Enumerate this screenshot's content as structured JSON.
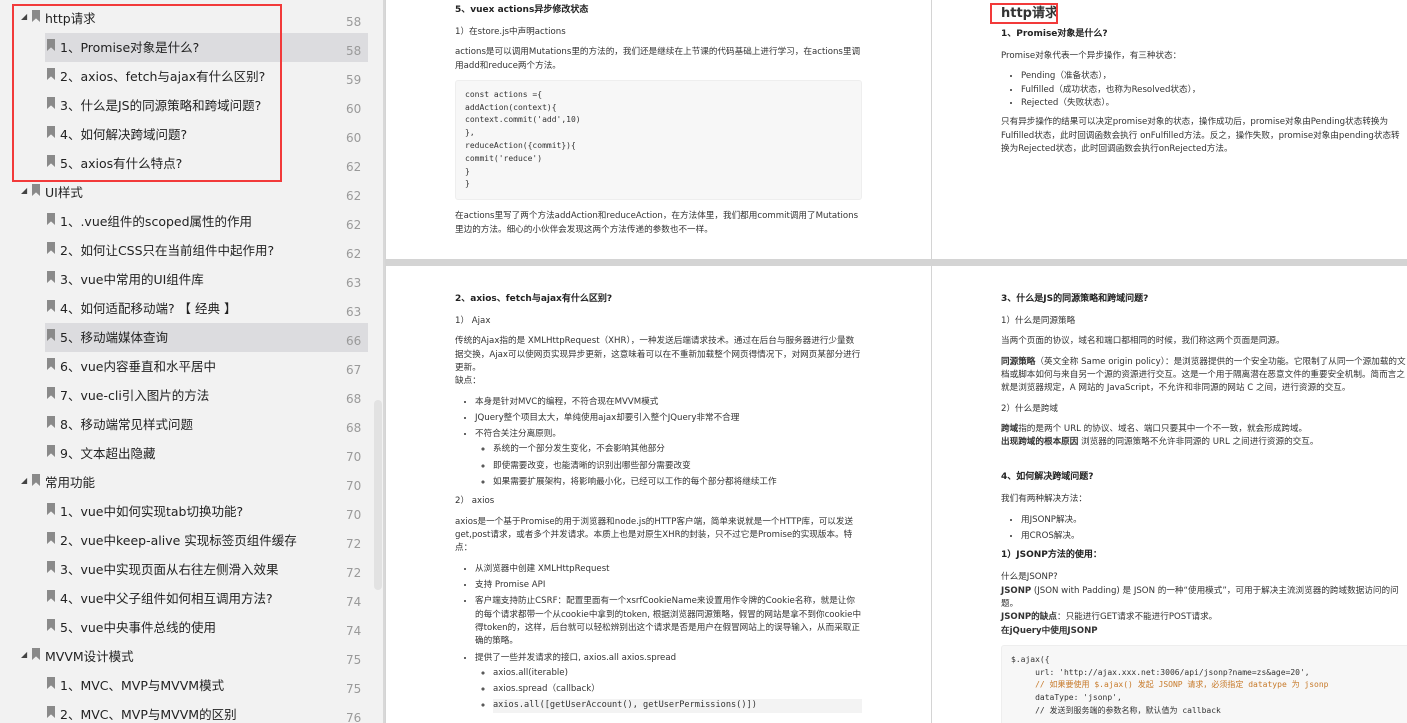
{
  "sidebar": {
    "items": [
      {
        "level": 0,
        "label": "http请求",
        "page": "58"
      },
      {
        "level": 1,
        "label": "1、Promise对象是什么?",
        "page": "58",
        "selected": true
      },
      {
        "level": 1,
        "label": "2、axios、fetch与ajax有什么区别?",
        "page": "59"
      },
      {
        "level": 1,
        "label": "3、什么是JS的同源策略和跨域问题?",
        "page": "60"
      },
      {
        "level": 1,
        "label": "4、如何解决跨域问题?",
        "page": "60"
      },
      {
        "level": 1,
        "label": "5、axios有什么特点?",
        "page": "62"
      },
      {
        "level": 0,
        "label": "UI样式",
        "page": "62"
      },
      {
        "level": 1,
        "label": "1、.vue组件的scoped属性的作用",
        "page": "62"
      },
      {
        "level": 1,
        "label": "2、如何让CSS只在当前组件中起作用?",
        "page": "62"
      },
      {
        "level": 1,
        "label": "3、vue中常用的UI组件库",
        "page": "63"
      },
      {
        "level": 1,
        "label": "4、如何适配移动端? 【 经典 】",
        "page": "63"
      },
      {
        "level": 1,
        "label": "5、移动端媒体查询",
        "page": "66",
        "selected": true
      },
      {
        "level": 1,
        "label": "6、vue内容垂直和水平居中",
        "page": "67"
      },
      {
        "level": 1,
        "label": "7、vue-cli引入图片的方法",
        "page": "68"
      },
      {
        "level": 1,
        "label": "8、移动端常见样式问题",
        "page": "68"
      },
      {
        "level": 1,
        "label": "9、文本超出隐藏",
        "page": "70"
      },
      {
        "level": 0,
        "label": "常用功能",
        "page": "70"
      },
      {
        "level": 1,
        "label": "1、vue中如何实现tab切换功能?",
        "page": "70"
      },
      {
        "level": 1,
        "label": "2、vue中keep-alive 实现标签页组件缓存",
        "page": "72"
      },
      {
        "level": 1,
        "label": "3、vue中实现页面从右往左侧滑入效果",
        "page": "72"
      },
      {
        "level": 1,
        "label": "4、vue中父子组件如何相互调用方法?",
        "page": "74"
      },
      {
        "level": 1,
        "label": "5、vue中央事件总线的使用",
        "page": "74"
      },
      {
        "level": 0,
        "label": "MVVM设计模式",
        "page": "75"
      },
      {
        "level": 1,
        "label": "1、MVC、MVP与MVVM模式",
        "page": "75"
      },
      {
        "level": 1,
        "label": "2、MVC、MVP与MVVM的区别",
        "page": "76"
      }
    ]
  },
  "p1": {
    "h": "5、vuex actions异步修改状态",
    "s1": "1）在store.js中声明actions",
    "para1": "actions是可以调用Mutations里的方法的，我们还是继续在上节课的代码基础上进行学习，在actions里调用add和reduce两个方法。",
    "code": "const actions ={\naddAction(context){\ncontext.commit('add',10)\n},\nreduceAction({commit}){\ncommit('reduce')\n}\n}",
    "para2": "在actions里写了两个方法addAction和reduceAction，在方法体里，我们都用commit调用了Mutations里边的方法。细心的小伙伴会发现这两个方法传递的参数也不一样。"
  },
  "p2": {
    "title": "http请求",
    "h": "1、Promise对象是什么?",
    "intro": "Promise对象代表一个异步操作，有三种状态：",
    "states": [
      "Pending（准备状态），",
      "Fulfilled（成功状态，也称为Resolved状态），",
      "Rejected（失败状态）。"
    ],
    "para": "只有异步操作的结果可以决定promise对象的状态，操作成功后，promise对象由Pending状态转换为Fulfilled状态，此时回调函数会执行 onFulfilled方法。反之，操作失败，promise对象由pending状态转换为Rejected状态，此时回调函数会执行onRejected方法。"
  },
  "p3": {
    "h": "2、axios、fetch与ajax有什么区别?",
    "s1": "1） Ajax",
    "ajax": "传统的Ajax指的是 XMLHttpRequest（XHR），一种发送后端请求技术。通过在后台与服务器进行少量数据交换，Ajax可以使网页实现异步更新，这意味着可以在不重新加载整个网页得情况下，对网页某部分进行更新。",
    "cons": "缺点：",
    "cons_list": [
      "本身是针对MVC的编程，不符合现在MVVM模式",
      "JQuery整个项目太大，单纯使用ajax却要引入整个JQuery非常不合理",
      "不符合关注分离原则。"
    ],
    "sub_list": [
      "系统的一个部分发生变化，不会影响其他部分",
      "即使需要改变，也能清晰的识别出哪些部分需要改变",
      "如果需要扩展架构，将影响最小化，已经可以工作的每个部分都将继续工作"
    ],
    "s2": "2） axios",
    "axios": "axios是一个基于Promise的用于浏览器和node.js的HTTP客户端，简单来说就是一个HTTP库，可以发送get,post请求，或者多个并发请求。本质上也是对原生XHR的封装，只不过它是Promise的实现版本。特点：",
    "features": [
      "从浏览器中创建 XMLHttpRequest",
      "支持 Promise API",
      "客户端支持防止CSRF：配置里面有一个xsrfCookieName来设置用作令牌的Cookie名称，就是让你的每个请求都带一个从cookie中拿到的token, 根据浏览器同源策略，假冒的网站是拿不到你cookie中得token的，这样，后台就可以轻松辨别出这个请求是否是用户在假冒网站上的误导输入，从而采取正确的策略。",
      "提供了一些并发请求的接口, axios.all axios.spread"
    ],
    "sub2": [
      "axios.all(iterable)",
      "axios.spread（callback）",
      "axios.all([getUserAccount(), getUserPermissions()])"
    ]
  },
  "p4": {
    "h3": "3、什么是JS的同源策略和跨域问题?",
    "s1": "1）什么是同源策略",
    "same": "当两个页面的协议，域名和端口都相同的时候，我们称这两个页面是同源。",
    "policy_b": "同源策略",
    "policy": "（英文全称 Same origin policy）：是浏览器提供的一个安全功能。它限制了从同一个源加载的文档或脚本如何与来自另一个源的资源进行交互。这是一个用于隔离潜在恶意文件的重要安全机制。简而言之就是浏览器规定，A 网站的 JavaScript，不允许和非同源的网站 C 之间，进行资源的交互。",
    "s2": "2）什么是跨域",
    "cross_b": "跨域",
    "cross": "指的是两个 URL 的协议、域名、端口只要其中一个不一致，就会形成跨域。",
    "root_b": "出现跨域的根本原因",
    "root": " 浏览器的同源策略不允许非同源的 URL 之间进行资源的交互。",
    "h4": "4、如何解决跨域问题?",
    "two": "我们有两种解决方法：",
    "ways": [
      "用JSONP解决。",
      "用CROS解决。"
    ],
    "jh": "1）JSONP方法的使用：",
    "what": "什么是JSONP?",
    "jsonp_b": "JSONP",
    "jsonp": " (JSON with Padding) 是 JSON 的一种“使用模式”，可用于解决主流浏览器的跨域数据访问的问题。",
    "cons_b": "JSONP的缺点",
    "cons": "：只能进行GET请求不能进行POST请求。",
    "injq": "在jQuery中使用JSONP",
    "code1": "$.ajax({\n     url: 'http://ajax.xxx.net:3006/api/jsonp?name=zs&age=20',\n",
    "code_comment": "     // 如果要使用 $.ajax() 发起 JSONP 请求，必须指定 datatype 为 jsonp\n",
    "code2": "     dataType: 'jsonp',\n     // 发送到服务端的参数名称，默认值为 callback"
  }
}
